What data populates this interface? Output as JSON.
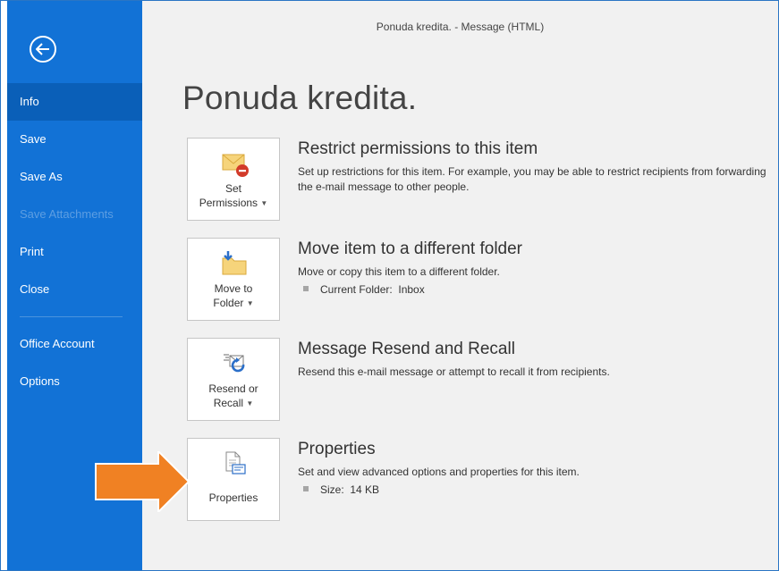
{
  "window": {
    "title": "Ponuda kredita. - Message (HTML)"
  },
  "sidebar": {
    "back_icon": "arrow-left-circle-icon",
    "items": [
      {
        "label": "Info",
        "active": true
      },
      {
        "label": "Save"
      },
      {
        "label": "Save As"
      },
      {
        "label": "Save Attachments",
        "disabled": true
      },
      {
        "label": "Print"
      },
      {
        "label": "Close"
      },
      {
        "label": "Office Account"
      },
      {
        "label": "Options"
      }
    ]
  },
  "page": {
    "title": "Ponuda kredita."
  },
  "sections": [
    {
      "button": {
        "line1": "Set",
        "line2": "Permissions",
        "icon": "envelope-restrict-icon"
      },
      "title": "Restrict permissions to this item",
      "description": "Set up restrictions for this item. For example, you may be able to restrict recipients from forwarding the e-mail message to other people."
    },
    {
      "button": {
        "line1": "Move to",
        "line2": "Folder",
        "icon": "folder-move-icon"
      },
      "title": "Move item to a different folder",
      "description": "Move or copy this item to a different folder.",
      "meta_label": "Current Folder:",
      "meta_value": "Inbox"
    },
    {
      "button": {
        "line1": "Resend or",
        "line2": "Recall",
        "icon": "message-resend-icon"
      },
      "title": "Message Resend and Recall",
      "description": "Resend this e-mail message or attempt to recall it from recipients."
    },
    {
      "button": {
        "line1": "Properties",
        "icon": "properties-document-icon"
      },
      "title": "Properties",
      "description": "Set and view advanced options and properties for this item.",
      "meta_label": "Size:",
      "meta_value": "14 KB"
    }
  ],
  "colors": {
    "sidebar": "#1272d6",
    "active_item": "#0a5fb8",
    "arrow": "#f08123",
    "background": "#f1f1f1"
  }
}
